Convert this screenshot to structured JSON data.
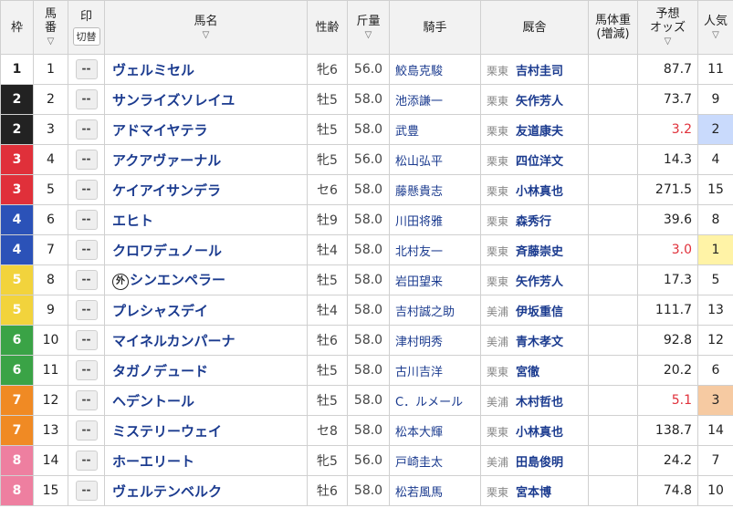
{
  "headers": {
    "waku": "枠",
    "umaban_1": "馬",
    "umaban_2": "番",
    "mark": "印",
    "mark_switch": "切替",
    "name": "馬名",
    "sexage": "性齢",
    "kinryo": "斤量",
    "jockey": "騎手",
    "stable": "厩舎",
    "weight_1": "馬体重",
    "weight_2": "(増減)",
    "odds_1": "予想",
    "odds_2": "オッズ",
    "pop": "人気"
  },
  "sort_icon": "chevron-down",
  "mark_placeholder": "--",
  "gaikoku_mark": "外",
  "horses": [
    {
      "waku": "1",
      "umaban": "1",
      "name": "ヴェルミセル",
      "sexage": "牝6",
      "kinryo": "56.0",
      "jockey": "鮫島克駿",
      "region": "栗東",
      "trainer": "吉村圭司",
      "odds": "87.7",
      "pop": "11",
      "gaikoku": false
    },
    {
      "waku": "2",
      "umaban": "2",
      "name": "サンライズソレイユ",
      "sexage": "牡5",
      "kinryo": "58.0",
      "jockey": "池添謙一",
      "region": "栗東",
      "trainer": "矢作芳人",
      "odds": "73.7",
      "pop": "9",
      "gaikoku": false
    },
    {
      "waku": "2",
      "umaban": "3",
      "name": "アドマイヤテラ",
      "sexage": "牡5",
      "kinryo": "58.0",
      "jockey": "武豊",
      "region": "栗東",
      "trainer": "友道康夫",
      "odds": "3.2",
      "pop": "2",
      "gaikoku": false
    },
    {
      "waku": "3",
      "umaban": "4",
      "name": "アクアヴァーナル",
      "sexage": "牝5",
      "kinryo": "56.0",
      "jockey": "松山弘平",
      "region": "栗東",
      "trainer": "四位洋文",
      "odds": "14.3",
      "pop": "4",
      "gaikoku": false
    },
    {
      "waku": "3",
      "umaban": "5",
      "name": "ケイアイサンデラ",
      "sexage": "セ6",
      "kinryo": "58.0",
      "jockey": "藤懸貴志",
      "region": "栗東",
      "trainer": "小林真也",
      "odds": "271.5",
      "pop": "15",
      "gaikoku": false
    },
    {
      "waku": "4",
      "umaban": "6",
      "name": "エヒト",
      "sexage": "牡9",
      "kinryo": "58.0",
      "jockey": "川田将雅",
      "region": "栗東",
      "trainer": "森秀行",
      "odds": "39.6",
      "pop": "8",
      "gaikoku": false
    },
    {
      "waku": "4",
      "umaban": "7",
      "name": "クロワデュノール",
      "sexage": "牡4",
      "kinryo": "58.0",
      "jockey": "北村友一",
      "region": "栗東",
      "trainer": "斉藤崇史",
      "odds": "3.0",
      "pop": "1",
      "gaikoku": false
    },
    {
      "waku": "5",
      "umaban": "8",
      "name": "シンエンペラー",
      "sexage": "牡5",
      "kinryo": "58.0",
      "jockey": "岩田望来",
      "region": "栗東",
      "trainer": "矢作芳人",
      "odds": "17.3",
      "pop": "5",
      "gaikoku": true
    },
    {
      "waku": "5",
      "umaban": "9",
      "name": "プレシャスデイ",
      "sexage": "牡4",
      "kinryo": "58.0",
      "jockey": "吉村誠之助",
      "region": "美浦",
      "trainer": "伊坂重信",
      "odds": "111.7",
      "pop": "13",
      "gaikoku": false
    },
    {
      "waku": "6",
      "umaban": "10",
      "name": "マイネルカンパーナ",
      "sexage": "牡6",
      "kinryo": "58.0",
      "jockey": "津村明秀",
      "region": "美浦",
      "trainer": "青木孝文",
      "odds": "92.8",
      "pop": "12",
      "gaikoku": false
    },
    {
      "waku": "6",
      "umaban": "11",
      "name": "タガノデュード",
      "sexage": "牡5",
      "kinryo": "58.0",
      "jockey": "古川吉洋",
      "region": "栗東",
      "trainer": "宮徹",
      "odds": "20.2",
      "pop": "6",
      "gaikoku": false
    },
    {
      "waku": "7",
      "umaban": "12",
      "name": "ヘデントール",
      "sexage": "牡5",
      "kinryo": "58.0",
      "jockey": "C．ルメール",
      "region": "美浦",
      "trainer": "木村哲也",
      "odds": "5.1",
      "pop": "3",
      "gaikoku": false
    },
    {
      "waku": "7",
      "umaban": "13",
      "name": "ミステリーウェイ",
      "sexage": "セ8",
      "kinryo": "58.0",
      "jockey": "松本大輝",
      "region": "栗東",
      "trainer": "小林真也",
      "odds": "138.7",
      "pop": "14",
      "gaikoku": false
    },
    {
      "waku": "8",
      "umaban": "14",
      "name": "ホーエリート",
      "sexage": "牝5",
      "kinryo": "56.0",
      "jockey": "戸崎圭太",
      "region": "美浦",
      "trainer": "田島俊明",
      "odds": "24.2",
      "pop": "7",
      "gaikoku": false
    },
    {
      "waku": "8",
      "umaban": "15",
      "name": "ヴェルテンベルク",
      "sexage": "牡6",
      "kinryo": "58.0",
      "jockey": "松若風馬",
      "region": "栗東",
      "trainer": "宮本博",
      "odds": "74.8",
      "pop": "10",
      "gaikoku": false
    }
  ],
  "colors": {
    "waku_1": "#ffffff",
    "waku_2": "#222222",
    "waku_3": "#e0303a",
    "waku_4": "#2b52b8",
    "waku_5": "#f2d33c",
    "waku_6": "#3aa346",
    "waku_7": "#f08a24",
    "waku_8": "#ee7fa0",
    "link_blue": "#1b3b8f",
    "odds_hot": "#e0303a",
    "pop_1": "#fff3a6",
    "pop_2": "#c9dafc",
    "pop_3": "#f6caa2"
  }
}
